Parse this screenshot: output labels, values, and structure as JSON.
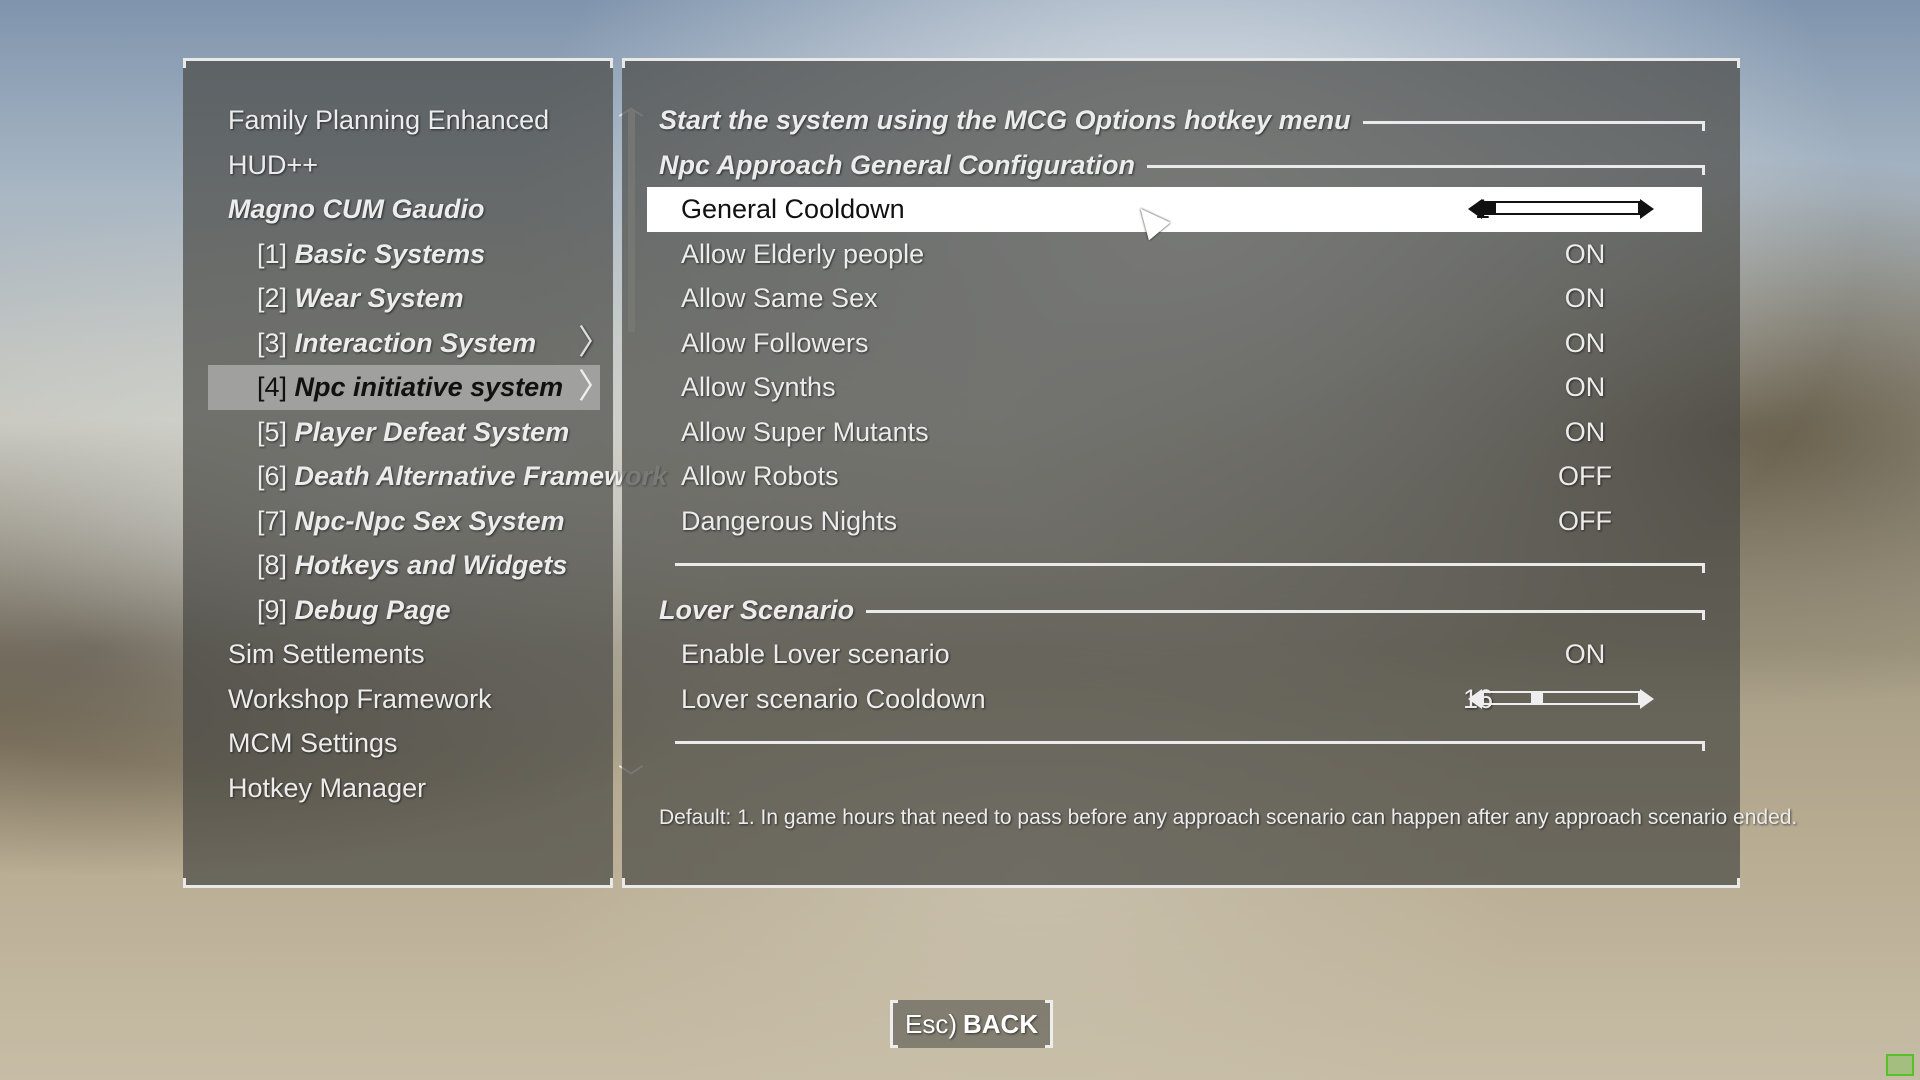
{
  "nav": {
    "items": [
      {
        "label": "Family Planning Enhanced"
      },
      {
        "label": "HUD++"
      },
      {
        "label": "Magno CUM Gaudio"
      },
      {
        "num": "[1]",
        "label": "Basic Systems"
      },
      {
        "num": "[2]",
        "label": "Wear System"
      },
      {
        "num": "[3]",
        "label": "Interaction System"
      },
      {
        "num": "[4]",
        "label": "Npc initiative system"
      },
      {
        "num": "[5]",
        "label": "Player Defeat System"
      },
      {
        "num": "[6]",
        "label": "Death Alternative Framework"
      },
      {
        "num": "[7]",
        "label": "Npc-Npc Sex System"
      },
      {
        "num": "[8]",
        "label": "Hotkeys and Widgets"
      },
      {
        "num": "[9]",
        "label": "Debug Page"
      },
      {
        "label": "Sim Settlements"
      },
      {
        "label": "Workshop Framework"
      },
      {
        "label": "MCM Settings"
      },
      {
        "label": "Hotkey Manager"
      }
    ],
    "selected_index": 6
  },
  "content": {
    "header": "Start the system using the MCG Options hotkey menu",
    "section1": "Npc Approach General Configuration",
    "general_cooldown": {
      "label": "General Cooldown",
      "value": "1",
      "fraction": 0.0
    },
    "toggles": [
      {
        "label": "Allow Elderly people",
        "value": "ON"
      },
      {
        "label": "Allow Same Sex",
        "value": "ON"
      },
      {
        "label": "Allow Followers",
        "value": "ON"
      },
      {
        "label": "Allow Synths",
        "value": "ON"
      },
      {
        "label": "Allow Super Mutants",
        "value": "ON"
      },
      {
        "label": "Allow Robots",
        "value": "OFF"
      },
      {
        "label": "Dangerous Nights",
        "value": "OFF"
      }
    ],
    "section2": "Lover Scenario",
    "enable_lover": {
      "label": "Enable Lover scenario",
      "value": "ON"
    },
    "lover_cooldown": {
      "label": "Lover scenario Cooldown",
      "value": "16",
      "fraction": 0.33
    },
    "description": "Default: 1. In game hours that need to pass before any approach scenario can happen after any approach scenario ended."
  },
  "footer": {
    "back_key": "Esc)",
    "back_label": "BACK"
  },
  "icons": {
    "scroll_up": "chevron-up-icon",
    "scroll_down": "chevron-down-icon",
    "cursor": "mouse-pointer-icon",
    "submenu": "chevron-right-icon"
  },
  "colors": {
    "panel_bg": "#48483f",
    "text": "#ececec",
    "highlight": "#ffffff"
  }
}
